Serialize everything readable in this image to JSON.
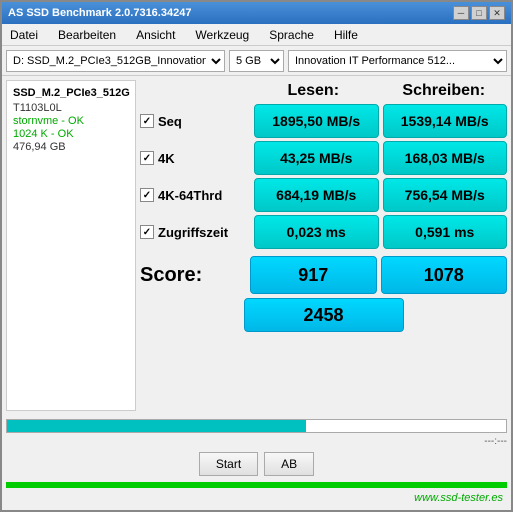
{
  "titleBar": {
    "title": "AS SSD Benchmark 2.0.7316.34247",
    "minBtn": "─",
    "maxBtn": "□",
    "closeBtn": "✕"
  },
  "menuBar": {
    "items": [
      "Datei",
      "Bearbeiten",
      "Ansicht",
      "Werkzeug",
      "Sprache",
      "Hilfe"
    ]
  },
  "toolbar": {
    "driveDropdown": "D: SSD_M.2_PCIe3_512GB_InnovationIT...",
    "sizeDropdown": "5 GB",
    "nameDropdown": "Innovation IT Performance 512..."
  },
  "leftPanel": {
    "driveName": "SSD_M.2_PCIe3_512G",
    "line1": "T1103L0L",
    "line2": "stornvme - OK",
    "line3": "1024 K - OK",
    "line4": "476,94 GB"
  },
  "headers": {
    "read": "Lesen:",
    "write": "Schreiben:"
  },
  "rows": [
    {
      "label": "Seq",
      "checked": true,
      "readValue": "1895,50 MB/s",
      "writeValue": "1539,14 MB/s"
    },
    {
      "label": "4K",
      "checked": true,
      "readValue": "43,25 MB/s",
      "writeValue": "168,03 MB/s"
    },
    {
      "label": "4K-64Thrd",
      "checked": true,
      "readValue": "684,19 MB/s",
      "writeValue": "756,54 MB/s"
    },
    {
      "label": "Zugriffszeit",
      "checked": true,
      "readValue": "0,023 ms",
      "writeValue": "0,591 ms"
    }
  ],
  "score": {
    "label": "Score:",
    "readScore": "917",
    "writeScore": "1078",
    "totalScore": "2458"
  },
  "status": {
    "progressText": "---:---"
  },
  "buttons": {
    "start": "Start",
    "ab": "AB"
  },
  "watermark": "www.ssd-tester.es"
}
